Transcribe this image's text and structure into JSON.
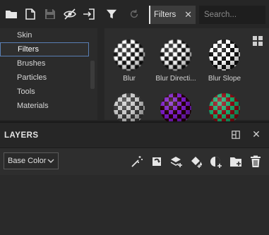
{
  "filter_tag": {
    "label": "Filters",
    "close": "✕"
  },
  "search": {
    "placeholder": "Search..."
  },
  "categories": [
    {
      "label": "Skin",
      "selected": false
    },
    {
      "label": "Filters",
      "selected": true
    },
    {
      "label": "Brushes",
      "selected": false
    },
    {
      "label": "Particles",
      "selected": false
    },
    {
      "label": "Tools",
      "selected": false
    },
    {
      "label": "Materials",
      "selected": false
    }
  ],
  "thumbnails": [
    {
      "label": "Blur",
      "style": "checker-blur"
    },
    {
      "label": "Blur Directi...",
      "style": "checker-blur"
    },
    {
      "label": "Blur Slope",
      "style": "checker-slope"
    },
    {
      "label": "",
      "style": "grey"
    },
    {
      "label": "",
      "style": "purple"
    },
    {
      "label": "",
      "style": "green"
    }
  ],
  "layers": {
    "title": "LAYERS",
    "close": "✕",
    "channel_value": "Base Color"
  },
  "icons": {
    "toolbar": [
      "folder-icon",
      "new-file-icon",
      "save-icon",
      "hide-icon",
      "export-icon"
    ],
    "layer_tools": [
      "magic-wand-icon",
      "rotate-mask-icon",
      "add-layer-icon",
      "fill-layer-icon",
      "smart-material-icon",
      "add-folder-icon",
      "delete-icon"
    ]
  },
  "colors": {
    "accent": "#5a7fb4",
    "background": "#2b2b2b",
    "text": "#d6d6d6"
  }
}
